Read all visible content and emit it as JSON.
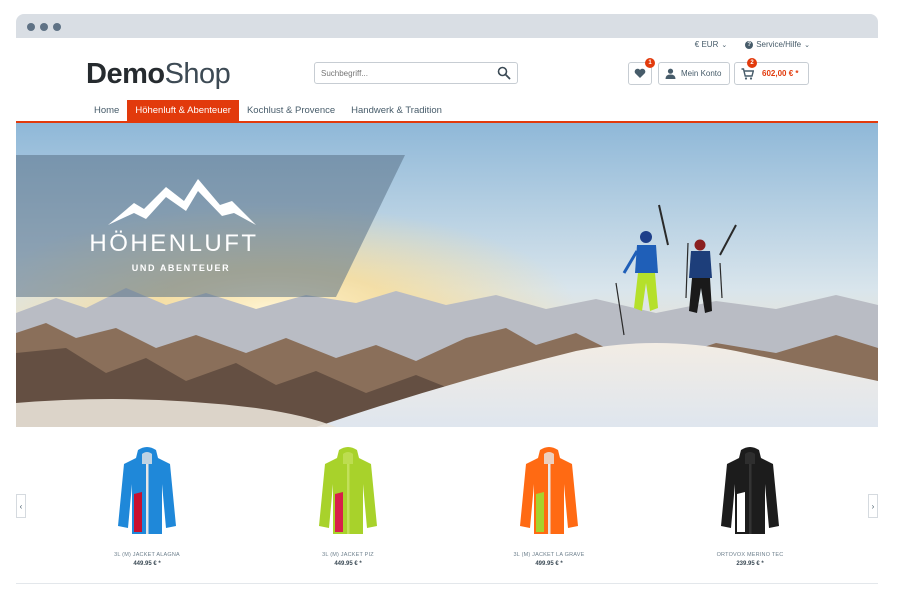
{
  "header": {
    "logo_bold": "Demo",
    "logo_light": "Shop",
    "currency": "€ EUR",
    "service": "Service/Hilfe",
    "search_placeholder": "Suchbegriff...",
    "wishlist_count": "1",
    "account_label": "Mein Konto",
    "cart_count": "2",
    "cart_total": "602,00 € *"
  },
  "nav": {
    "items": [
      "Home",
      "Höhenluft & Abenteuer",
      "Kochlust & Provence",
      "Handwerk & Tradition"
    ],
    "active_index": 1
  },
  "hero": {
    "title": "HÖHENLUFT",
    "subtitle": "UND ABENTEUER"
  },
  "products": [
    {
      "name": "3L (M) JACKET ALAGNA",
      "price": "449.95 € *",
      "colors": [
        "#1f88d9",
        "#c8102e",
        "#e6e6e6"
      ]
    },
    {
      "name": "3L (M) JACKET PIZ",
      "price": "449.95 € *",
      "colors": [
        "#a8d22b",
        "#d81f4a",
        "#c2e05a"
      ]
    },
    {
      "name": "3L (M) JACKET LA GRAVE",
      "price": "499.95 € *",
      "colors": [
        "#ff6a13",
        "#a8d22b",
        "#e8e8e8"
      ]
    },
    {
      "name": "ORTOVOX MERINO TEC",
      "price": "239.95 € *",
      "colors": [
        "#1c1c1c",
        "#ffffff",
        "#333333"
      ]
    }
  ],
  "colors": {
    "accent": "#e23a0c",
    "text": "#475c6a"
  }
}
